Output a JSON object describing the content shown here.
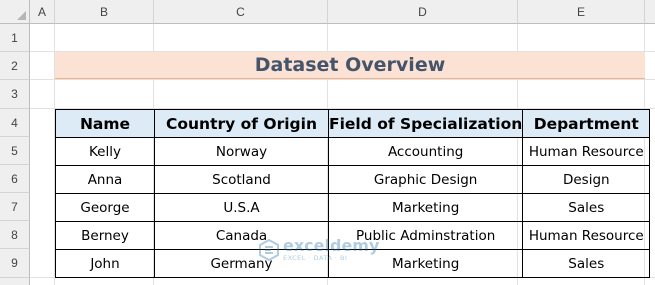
{
  "columns": [
    "A",
    "B",
    "C",
    "D",
    "E"
  ],
  "rows": [
    "1",
    "2",
    "3",
    "4",
    "5",
    "6",
    "7",
    "8",
    "9"
  ],
  "title": "Dataset Overview",
  "table": {
    "headers": [
      "Name",
      "Country of Origin",
      "Field of Specialization",
      "Department"
    ],
    "rows": [
      [
        "Kelly",
        "Norway",
        "Accounting",
        "Human Resource"
      ],
      [
        "Anna",
        "Scotland",
        "Graphic Design",
        "Design"
      ],
      [
        "George",
        "U.S.A",
        "Marketing",
        "Sales"
      ],
      [
        "Berney",
        "Canada",
        "Public Adminstration",
        "Human Resource"
      ],
      [
        "John",
        "Germany",
        "Marketing",
        "Sales"
      ]
    ]
  },
  "watermark": {
    "name": "exceldemy",
    "tagline": "EXCEL · DATA · BI",
    "logo_icon": "exceldemy-logo-icon"
  },
  "colors": {
    "title_band": "#fbe2d5",
    "title_text": "#44546a",
    "header_fill": "#ddebf7"
  }
}
